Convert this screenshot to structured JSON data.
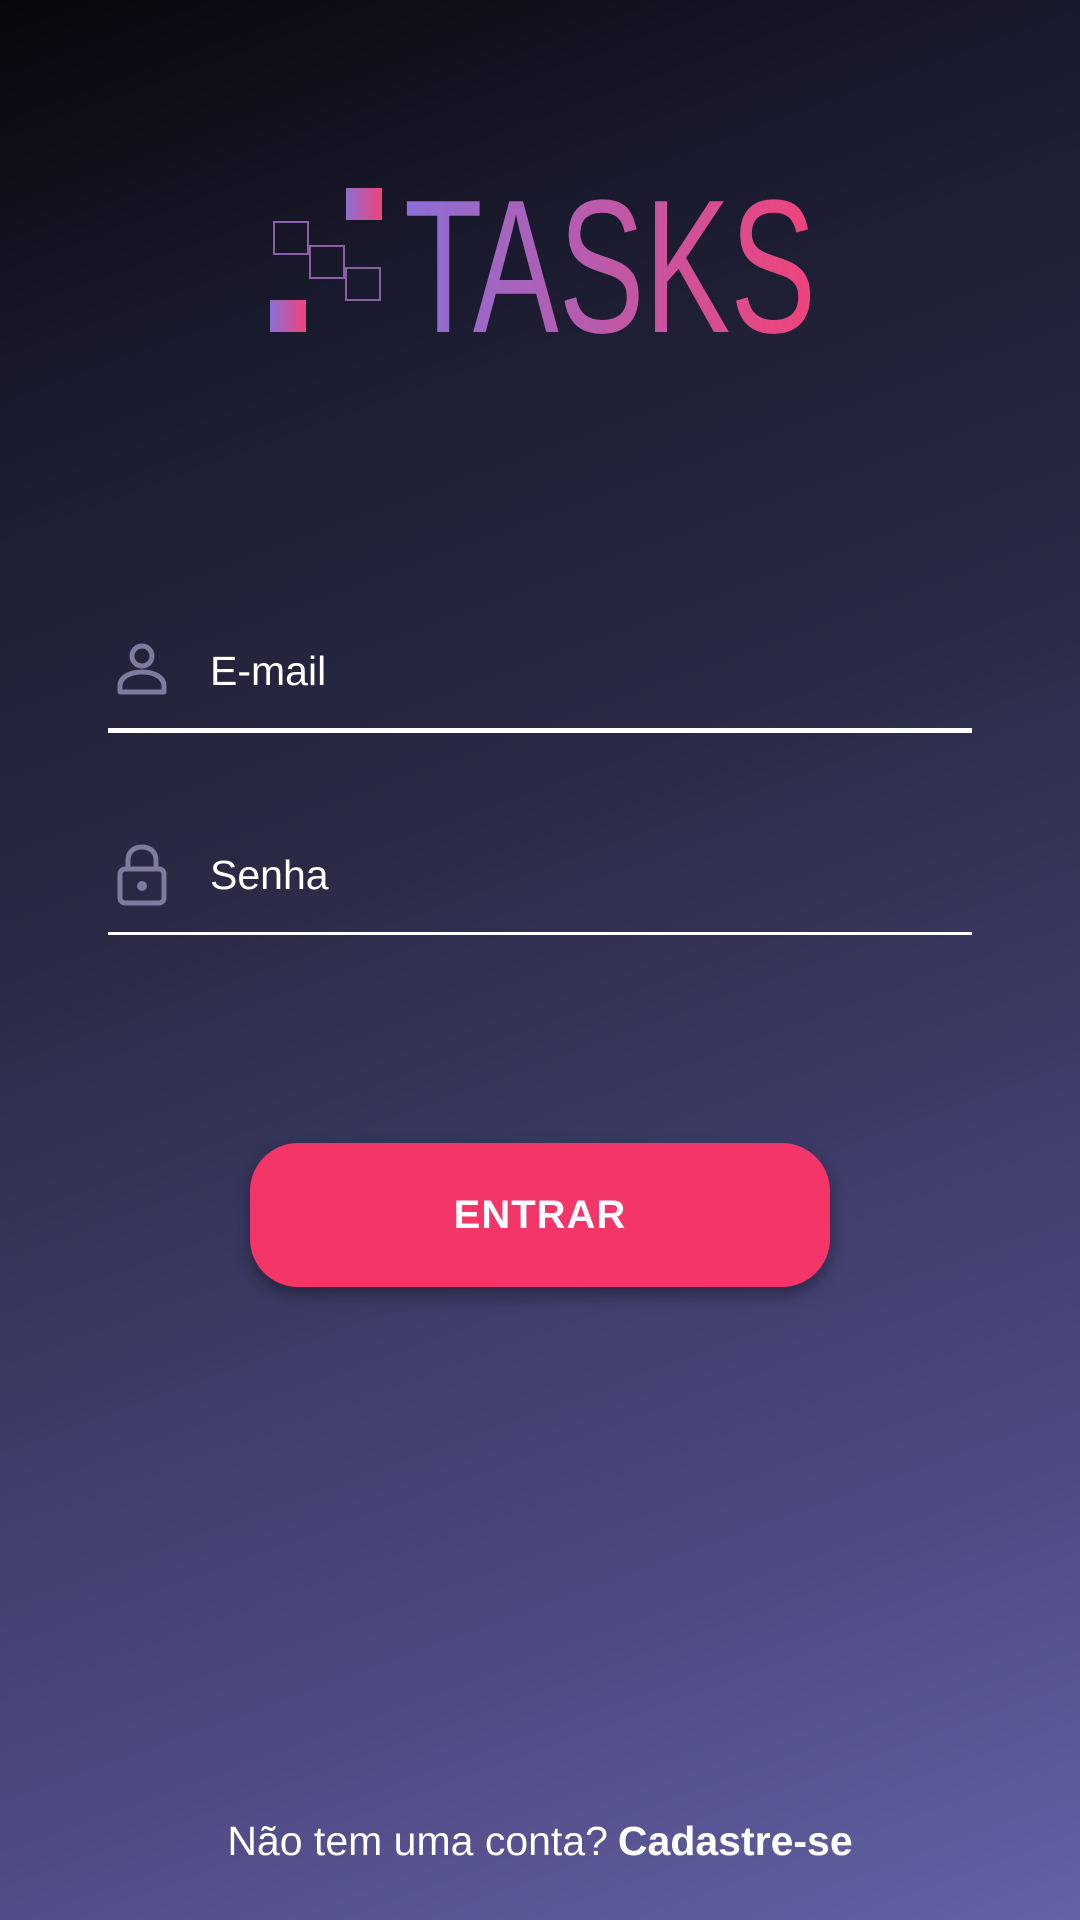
{
  "app": {
    "logo_text": "TASKS"
  },
  "colors": {
    "accent": "#f33567",
    "logo_gradient_start": "#8b6fd6",
    "logo_gradient_end": "#f0437a",
    "icon_color": "#7e7b9f"
  },
  "form": {
    "email": {
      "icon": "person-icon",
      "placeholder": "E-mail",
      "value": ""
    },
    "password": {
      "icon": "lock-icon",
      "placeholder": "Senha",
      "value": ""
    },
    "submit_label": "ENTRAR"
  },
  "footer": {
    "prompt": "Não tem uma conta?",
    "signup_link": "Cadastre-se"
  }
}
